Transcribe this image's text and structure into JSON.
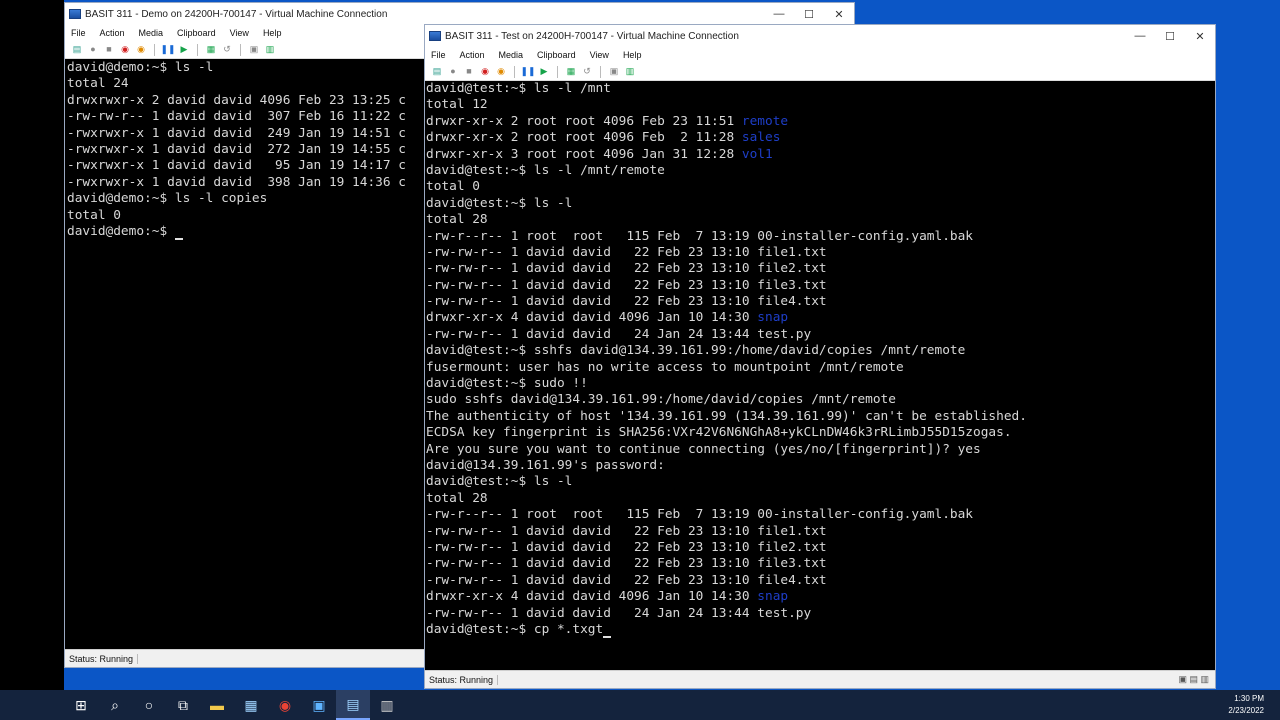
{
  "colors": {
    "desktop_blue": "#0b56c6",
    "terminal_bg": "#000000",
    "dir_color": "#1e3ec8",
    "taskbar": "#14233d"
  },
  "window_left": {
    "title": "BASIT 311 - Demo on 24200H-700147 - Virtual Machine Connection",
    "menu": [
      "File",
      "Action",
      "Media",
      "Clipboard",
      "View",
      "Help"
    ],
    "status": "Status: Running",
    "terminal_lines": [
      "david@demo:~$ ls -l",
      "total 24",
      "drwxrwxr-x 2 david david 4096 Feb 23 13:25 c",
      "-rw-rw-r-- 1 david david  307 Feb 16 11:22 c",
      "-rwxrwxr-x 1 david david  249 Jan 19 14:51 c",
      "-rwxrwxr-x 1 david david  272 Jan 19 14:55 c",
      "-rwxrwxr-x 1 david david   95 Jan 19 14:17 c",
      "-rwxrwxr-x 1 david david  398 Jan 19 14:36 c",
      "david@demo:~$ ls -l copies",
      "total 0",
      "david@demo:~$ "
    ]
  },
  "window_right": {
    "title": "BASIT 311 - Test on 24200H-700147 - Virtual Machine Connection",
    "menu": [
      "File",
      "Action",
      "Media",
      "Clipboard",
      "View",
      "Help"
    ],
    "status": "Status: Running",
    "terminal_lines": [
      {
        "t": "david@test:~$ ls -l /mnt"
      },
      {
        "t": "total 12"
      },
      {
        "t": "drwxr-xr-x 2 root root 4096 Feb 23 11:51 ",
        "d": "remote"
      },
      {
        "t": "drwxr-xr-x 2 root root 4096 Feb  2 11:28 ",
        "d": "sales"
      },
      {
        "t": "drwxr-xr-x 3 root root 4096 Jan 31 12:28 ",
        "d": "vol1"
      },
      {
        "t": "david@test:~$ ls -l /mnt/remote"
      },
      {
        "t": "total 0"
      },
      {
        "t": "david@test:~$ ls -l"
      },
      {
        "t": "total 28"
      },
      {
        "t": "-rw-r--r-- 1 root  root   115 Feb  7 13:19 00-installer-config.yaml.bak"
      },
      {
        "t": "-rw-rw-r-- 1 david david   22 Feb 23 13:10 file1.txt"
      },
      {
        "t": "-rw-rw-r-- 1 david david   22 Feb 23 13:10 file2.txt"
      },
      {
        "t": "-rw-rw-r-- 1 david david   22 Feb 23 13:10 file3.txt"
      },
      {
        "t": "-rw-rw-r-- 1 david david   22 Feb 23 13:10 file4.txt"
      },
      {
        "t": "drwxr-xr-x 4 david david 4096 Jan 10 14:30 ",
        "d": "snap"
      },
      {
        "t": "-rw-rw-r-- 1 david david   24 Jan 24 13:44 test.py"
      },
      {
        "t": "david@test:~$ sshfs david@134.39.161.99:/home/david/copies /mnt/remote"
      },
      {
        "t": "fusermount: user has no write access to mountpoint /mnt/remote"
      },
      {
        "t": "david@test:~$ sudo !!"
      },
      {
        "t": "sudo sshfs david@134.39.161.99:/home/david/copies /mnt/remote"
      },
      {
        "t": "The authenticity of host '134.39.161.99 (134.39.161.99)' can't be established."
      },
      {
        "t": "ECDSA key fingerprint is SHA256:VXr42V6N6NGhA8+ykCLnDW46k3rRLimbJ55D15zogas."
      },
      {
        "t": "Are you sure you want to continue connecting (yes/no/[fingerprint])? yes"
      },
      {
        "t": "david@134.39.161.99's password:"
      },
      {
        "t": "david@test:~$ ls -l"
      },
      {
        "t": "total 28"
      },
      {
        "t": "-rw-r--r-- 1 root  root   115 Feb  7 13:19 00-installer-config.yaml.bak"
      },
      {
        "t": "-rw-rw-r-- 1 david david   22 Feb 23 13:10 file1.txt"
      },
      {
        "t": "-rw-rw-r-- 1 david david   22 Feb 23 13:10 file2.txt"
      },
      {
        "t": "-rw-rw-r-- 1 david david   22 Feb 23 13:10 file3.txt"
      },
      {
        "t": "-rw-rw-r-- 1 david david   22 Feb 23 13:10 file4.txt"
      },
      {
        "t": "drwxr-xr-x 4 david david 4096 Jan 10 14:30 ",
        "d": "snap"
      },
      {
        "t": "-rw-rw-r-- 1 david david   24 Jan 24 13:44 test.py"
      },
      {
        "t": "david@test:~$ cp *.txgt",
        "cursor": true
      }
    ]
  },
  "taskbar": {
    "icons": [
      "windows-start-icon",
      "search-icon",
      "cortana-icon",
      "task-view-icon",
      "file-explorer-icon",
      "calculator-icon",
      "chrome-icon",
      "store-icon",
      "vm-connect-icon",
      "notepad-icon"
    ],
    "clock_time": "1:30 PM",
    "clock_date": "2/23/2022"
  }
}
